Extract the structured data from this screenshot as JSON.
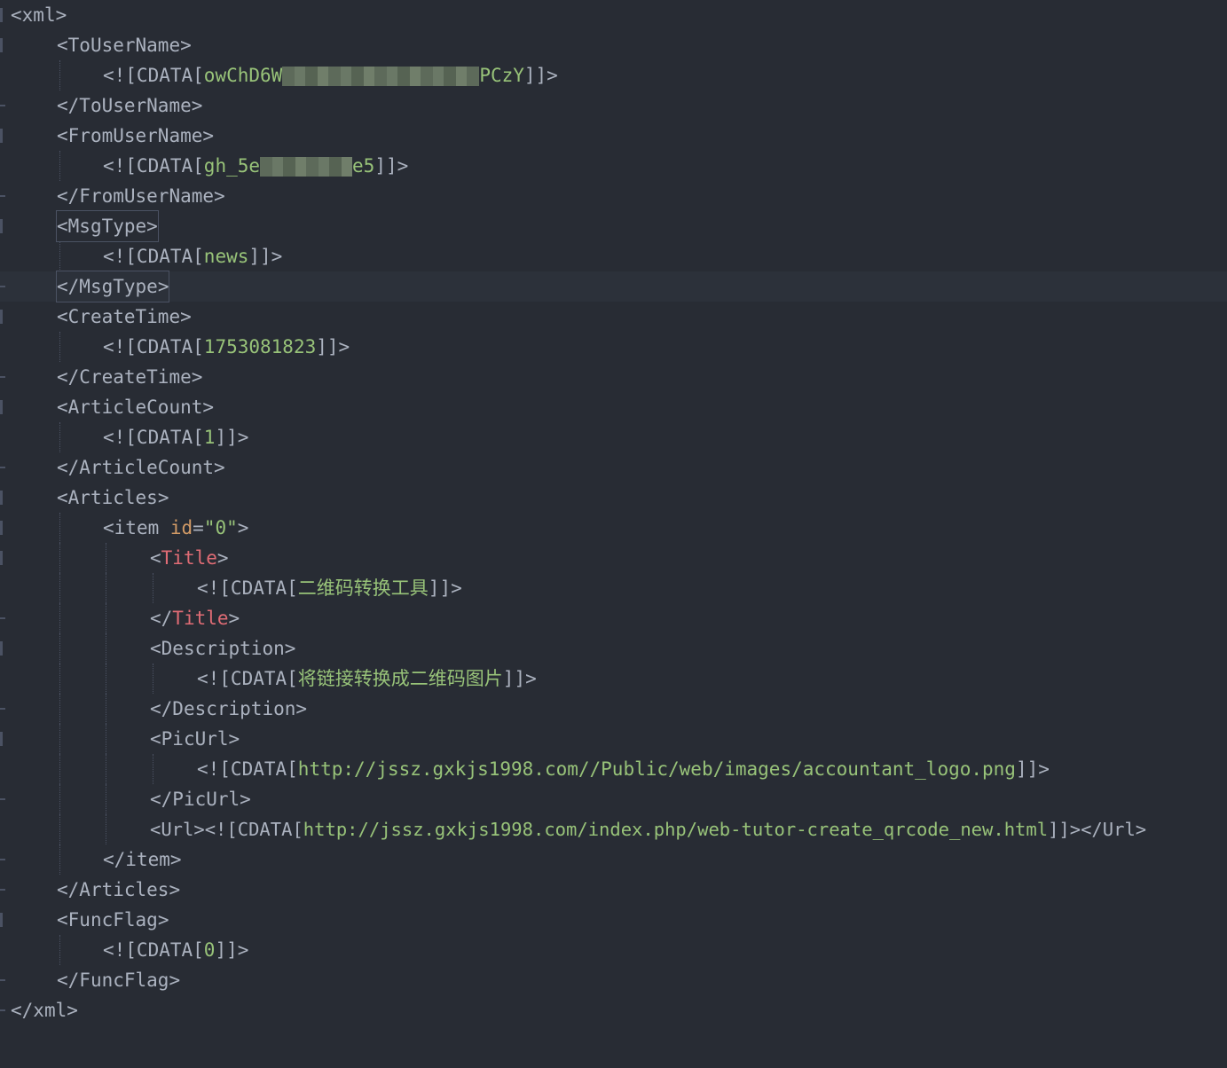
{
  "editor": {
    "colors": {
      "background": "#282c34",
      "text": "#abb2bf",
      "cdata_value": "#98c379",
      "title_tag": "#e06c75",
      "attribute": "#d19a66",
      "current_line": "#2c313a"
    },
    "lines": [
      {
        "open": "<",
        "name": "xml",
        "close": ">"
      },
      {
        "open": "<",
        "name": "ToUserName",
        "close": ">"
      },
      {
        "pre": "<![CDATA[",
        "value_a": "owChD6W",
        "value_b": "PCzY",
        "post": "]]>"
      },
      {
        "open": "</",
        "name": "ToUserName",
        "close": ">"
      },
      {
        "open": "<",
        "name": "FromUserName",
        "close": ">"
      },
      {
        "pre": "<![CDATA[",
        "value_a": "gh_5e",
        "value_b": "e5",
        "post": "]]>"
      },
      {
        "open": "</",
        "name": "FromUserName",
        "close": ">"
      },
      {
        "open": "<",
        "name": "MsgType",
        "close": ">"
      },
      {
        "pre": "<![CDATA[",
        "value": "news",
        "post": "]]>"
      },
      {
        "open": "</",
        "name": "MsgType",
        "close": ">"
      },
      {
        "open": "<",
        "name": "CreateTime",
        "close": ">"
      },
      {
        "pre": "<![CDATA[",
        "value": "1753081823",
        "post": "]]>"
      },
      {
        "open": "</",
        "name": "CreateTime",
        "close": ">"
      },
      {
        "open": "<",
        "name": "ArticleCount",
        "close": ">"
      },
      {
        "pre": "<![CDATA[",
        "value": "1",
        "post": "]]>"
      },
      {
        "open": "</",
        "name": "ArticleCount",
        "close": ">"
      },
      {
        "open": "<",
        "name": "Articles",
        "close": ">"
      },
      {
        "open": "<",
        "name": "item ",
        "attr": "id",
        "eq": "=",
        "str": "\"0\"",
        "close": ">"
      },
      {
        "open": "<",
        "name": "Title",
        "close": ">"
      },
      {
        "pre": "<![CDATA[",
        "value": "二维码转换工具",
        "post": "]]>"
      },
      {
        "open": "</",
        "name": "Title",
        "close": ">"
      },
      {
        "open": "<",
        "name": "Description",
        "close": ">"
      },
      {
        "pre": "<![CDATA[",
        "value": "将链接转换成二维码图片",
        "post": "]]>"
      },
      {
        "open": "</",
        "name": "Description",
        "close": ">"
      },
      {
        "open": "<",
        "name": "PicUrl",
        "close": ">"
      },
      {
        "pre": "<![CDATA[",
        "value": "http://jssz.gxkjs1998.com//Public/web/images/accountant_logo.png",
        "post": "]]>"
      },
      {
        "open": "</",
        "name": "PicUrl",
        "close": ">"
      },
      {
        "pre": "<Url><![CDATA[",
        "value": "http://jssz.gxkjs1998.com/index.php/web-tutor-create_qrcode_new.html",
        "post": "]]></Url>"
      },
      {
        "open": "</",
        "name": "item",
        "close": ">"
      },
      {
        "open": "</",
        "name": "Articles",
        "close": ">"
      },
      {
        "open": "<",
        "name": "FuncFlag",
        "close": ">"
      },
      {
        "pre": "<![CDATA[",
        "value": "0",
        "post": "]]>"
      },
      {
        "open": "</",
        "name": "FuncFlag",
        "close": ">"
      },
      {
        "open": "</",
        "name": "xml",
        "close": ">"
      }
    ]
  }
}
